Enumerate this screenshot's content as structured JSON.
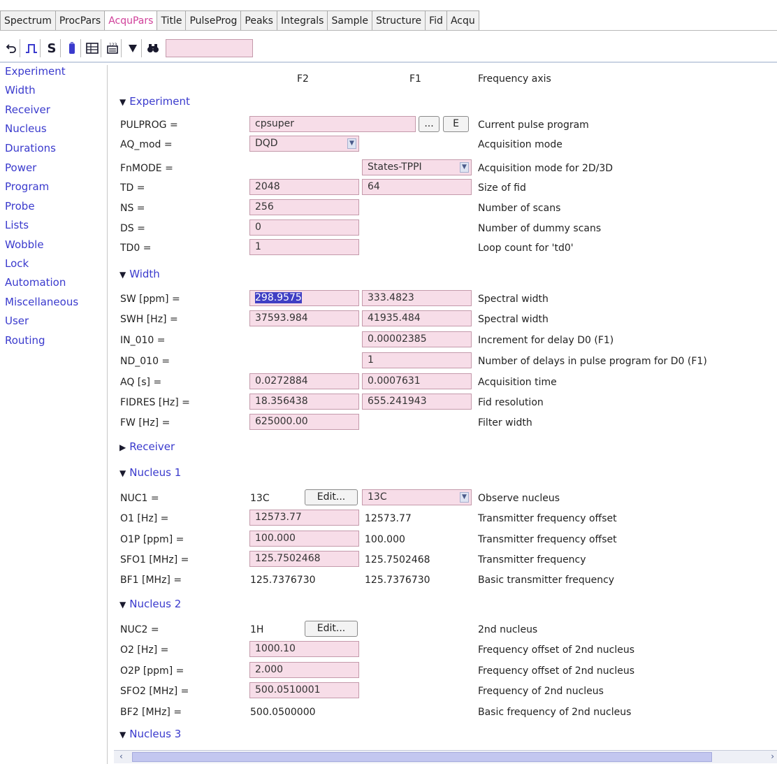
{
  "tabs": [
    {
      "label": "Spectrum",
      "active": false
    },
    {
      "label": "ProcPars",
      "active": false
    },
    {
      "label": "AcquPars",
      "active": true
    },
    {
      "label": "Title",
      "active": false
    },
    {
      "label": "PulseProg",
      "active": false
    },
    {
      "label": "Peaks",
      "active": false
    },
    {
      "label": "Integrals",
      "active": false
    },
    {
      "label": "Sample",
      "active": false
    },
    {
      "label": "Structure",
      "active": false
    },
    {
      "label": "Fid",
      "active": false
    },
    {
      "label": "Acqu",
      "active": false
    }
  ],
  "toolbar": {
    "icons": [
      "undo-icon",
      "pulse-icon",
      "s-icon",
      "probe-icon",
      "table-icon",
      "status-icon",
      "triangle-down-icon",
      "binoculars-icon"
    ],
    "s_label": "S",
    "search_value": ""
  },
  "sidebar": {
    "items": [
      "Experiment",
      "Width",
      "Receiver",
      "Nucleus",
      "Durations",
      "Power",
      "Program",
      "Probe",
      "Lists",
      "Wobble",
      "Lock",
      "Automation",
      "Miscellaneous",
      "User",
      "Routing"
    ]
  },
  "header": {
    "f2": "F2",
    "f1": "F1",
    "desc": "Frequency axis"
  },
  "sections": {
    "experiment": "Experiment",
    "width": "Width",
    "receiver": "Receiver",
    "nucleus1": "Nucleus 1",
    "nucleus2": "Nucleus 2",
    "nucleus3": "Nucleus 3"
  },
  "params": {
    "pulprog": {
      "label": "PULPROG =",
      "f2": "cpsuper",
      "browse": "...",
      "edit": "E",
      "desc": "Current pulse program"
    },
    "aq_mod": {
      "label": "AQ_mod =",
      "f2": "DQD",
      "desc": "Acquisition mode"
    },
    "fnmode": {
      "label": "FnMODE =",
      "f1": "States-TPPI",
      "desc": "Acquisition mode for 2D/3D"
    },
    "td": {
      "label": "TD =",
      "f2": "2048",
      "f1": "64",
      "desc": "Size of fid"
    },
    "ns": {
      "label": "NS =",
      "f2": "256",
      "desc": "Number of scans"
    },
    "ds": {
      "label": "DS =",
      "f2": "0",
      "desc": "Number of dummy scans"
    },
    "td0": {
      "label": "TD0 =",
      "f2": "1",
      "desc": "Loop count for 'td0'"
    },
    "sw": {
      "label": "SW [ppm] =",
      "f2": "298.9575",
      "f1": "333.4823",
      "desc": "Spectral width"
    },
    "swh": {
      "label": "SWH [Hz] =",
      "f2": "37593.984",
      "f1": "41935.484",
      "desc": "Spectral width"
    },
    "in_010": {
      "label": "IN_010 =",
      "f1": "0.00002385",
      "desc": "Increment for delay D0 (F1)"
    },
    "nd_010": {
      "label": "ND_010 =",
      "f1": "1",
      "desc": "Number of delays in pulse program for D0 (F1)"
    },
    "aq": {
      "label": "AQ [s] =",
      "f2": "0.0272884",
      "f1": "0.0007631",
      "desc": "Acquisition time"
    },
    "fidres": {
      "label": "FIDRES [Hz] =",
      "f2": "18.356438",
      "f1": "655.241943",
      "desc": "Fid resolution"
    },
    "fw": {
      "label": "FW [Hz] =",
      "f2": "625000.00",
      "desc": "Filter width"
    },
    "nuc1": {
      "label": "NUC1 =",
      "f2": "13C",
      "edit": "Edit...",
      "f1": "13C",
      "desc": "Observe nucleus"
    },
    "o1": {
      "label": "O1 [Hz] =",
      "f2": "12573.77",
      "f1": "12573.77",
      "desc": "Transmitter frequency offset"
    },
    "o1p": {
      "label": "O1P [ppm] =",
      "f2": "100.000",
      "f1": "100.000",
      "desc": "Transmitter frequency offset"
    },
    "sfo1": {
      "label": "SFO1 [MHz] =",
      "f2": "125.7502468",
      "f1": "125.7502468",
      "desc": "Transmitter frequency"
    },
    "bf1": {
      "label": "BF1 [MHz] =",
      "f2": "125.7376730",
      "f1": "125.7376730",
      "desc": "Basic transmitter frequency"
    },
    "nuc2": {
      "label": "NUC2 =",
      "f2": "1H",
      "edit": "Edit...",
      "desc": "2nd nucleus"
    },
    "o2": {
      "label": "O2 [Hz] =",
      "f2": "1000.10",
      "desc": "Frequency offset of 2nd nucleus"
    },
    "o2p": {
      "label": "O2P [ppm] =",
      "f2": "2.000",
      "desc": "Frequency offset of 2nd nucleus"
    },
    "sfo2": {
      "label": "SFO2 [MHz] =",
      "f2": "500.0510001",
      "desc": "Frequency of 2nd nucleus"
    },
    "bf2": {
      "label": "BF2 [MHz] =",
      "f2": "500.0500000",
      "desc": "Basic frequency of 2nd nucleus"
    }
  },
  "colors": {
    "accent": "#3a3acd",
    "field_bg": "#f7dde8",
    "active_tab": "#d0409a",
    "selection": "#3f3fc4"
  }
}
